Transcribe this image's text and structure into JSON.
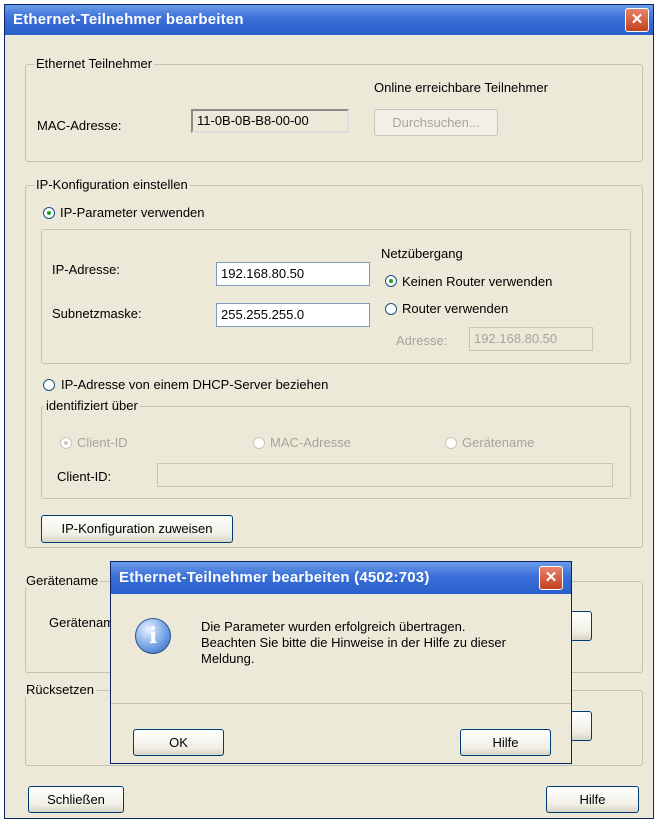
{
  "window": {
    "title": "Ethernet-Teilnehmer bearbeiten",
    "close_glyph": "✕"
  },
  "ethernet_group": {
    "legend": "Ethernet Teilnehmer",
    "online_label": "Online erreichbare Teilnehmer",
    "mac_label": "MAC-Adresse:",
    "mac_value": "11-0B-0B-B8-00-00",
    "browse_label": "Durchsuchen..."
  },
  "ip_group": {
    "legend": "IP-Konfiguration einstellen",
    "use_ip_params_label": "IP-Parameter verwenden",
    "ip_label": "IP-Adresse:",
    "ip_value": "192.168.80.50",
    "subnet_label": "Subnetzmaske:",
    "subnet_value": "255.255.255.0",
    "gateway_title": "Netzübergang",
    "no_router_label": "Keinen Router verwenden",
    "use_router_label": "Router verwenden",
    "address_label": "Adresse:",
    "address_value": "192.168.80.50",
    "dhcp_label": "IP-Adresse von einem DHCP-Server beziehen",
    "identified_legend": "identifiziert über",
    "client_id_radio": "Client-ID",
    "mac_radio": "MAC-Adresse",
    "device_name_radio": "Gerätename",
    "client_id_field_label": "Client-ID:",
    "client_id_value": "",
    "assign_button": "IP-Konfiguration zuweisen"
  },
  "device_name_group": {
    "legend": "Gerätename",
    "label": "Gerätenam"
  },
  "reset_group": {
    "legend": "Rücksetzen"
  },
  "footer": {
    "close_button": "Schließen",
    "help_button": "Hilfe"
  },
  "modal": {
    "title": "Ethernet-Teilnehmer bearbeiten  (4502:703)",
    "close_glyph": "✕",
    "icon": "info-icon",
    "icon_glyph": "i",
    "line1": "Die Parameter wurden erfolgreich übertragen.",
    "line2": "Beachten Sie bitte die Hinweise in der Hilfe zu dieser",
    "line3": "Meldung.",
    "ok_button": "OK",
    "help_button": "Hilfe"
  }
}
